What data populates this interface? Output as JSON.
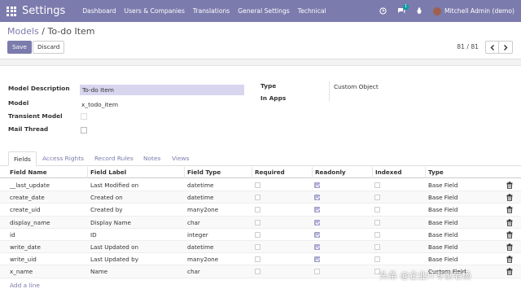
{
  "navbar": {
    "app_title": "Settings",
    "menu": [
      "Dashboard",
      "Users & Companies",
      "Translations",
      "General Settings",
      "Technical"
    ],
    "chat_badge": "1",
    "user_name": "Mitchell Admin (demo)"
  },
  "breadcrumb": {
    "parent": "Models",
    "separator": "/",
    "current": "To-do Item"
  },
  "buttons": {
    "save": "Save",
    "discard": "Discard"
  },
  "pager": {
    "text": "81 / 81"
  },
  "form": {
    "model_description_label": "Model Description",
    "model_description_value": "To-do Item",
    "model_label": "Model",
    "model_value": "x_todo_item",
    "transient_label": "Transient Model",
    "mail_thread_label": "Mail Thread",
    "type_label": "Type",
    "type_value": "Custom Object",
    "in_apps_label": "In Apps"
  },
  "tabs": [
    "Fields",
    "Access Rights",
    "Record Rules",
    "Notes",
    "Views"
  ],
  "table": {
    "columns": [
      "Field Name",
      "Field Label",
      "Field Type",
      "Required",
      "Readonly",
      "Indexed",
      "Type"
    ],
    "rows": [
      {
        "name": "__last_update",
        "label": "Last Modified on",
        "ftype": "datetime",
        "required": false,
        "readonly": true,
        "indexed": false,
        "type": "Base Field"
      },
      {
        "name": "create_date",
        "label": "Created on",
        "ftype": "datetime",
        "required": false,
        "readonly": true,
        "indexed": false,
        "type": "Base Field"
      },
      {
        "name": "create_uid",
        "label": "Created by",
        "ftype": "many2one",
        "required": false,
        "readonly": true,
        "indexed": false,
        "type": "Base Field"
      },
      {
        "name": "display_name",
        "label": "Display Name",
        "ftype": "char",
        "required": false,
        "readonly": true,
        "indexed": false,
        "type": "Base Field"
      },
      {
        "name": "id",
        "label": "ID",
        "ftype": "integer",
        "required": false,
        "readonly": true,
        "indexed": false,
        "type": "Base Field"
      },
      {
        "name": "write_date",
        "label": "Last Updated on",
        "ftype": "datetime",
        "required": false,
        "readonly": true,
        "indexed": false,
        "type": "Base Field"
      },
      {
        "name": "write_uid",
        "label": "Last Updated by",
        "ftype": "many2one",
        "required": false,
        "readonly": true,
        "indexed": false,
        "type": "Base Field"
      },
      {
        "name": "x_name",
        "label": "Name",
        "ftype": "char",
        "required": false,
        "readonly": false,
        "indexed": false,
        "type": "Custom Field"
      }
    ],
    "add_line": "Add a line"
  },
  "watermark": "头条 @企业IT专家老杨",
  "colors": {
    "brand": "#7c7bad",
    "input_bg": "#d8d5ef",
    "badge": "#00a09d"
  }
}
